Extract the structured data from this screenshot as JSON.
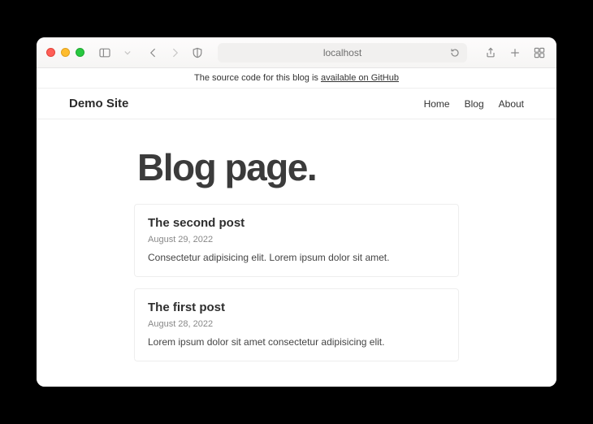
{
  "browser": {
    "address": "localhost"
  },
  "notice": {
    "prefix": "The source code for this blog is ",
    "link": "available on GitHub"
  },
  "site": {
    "title": "Demo Site",
    "nav": [
      "Home",
      "Blog",
      "About"
    ]
  },
  "page": {
    "heading": "Blog page."
  },
  "posts": [
    {
      "title": "The second post",
      "date": "August 29, 2022",
      "excerpt": "Consectetur adipisicing elit. Lorem ipsum dolor sit amet."
    },
    {
      "title": "The first post",
      "date": "August 28, 2022",
      "excerpt": "Lorem ipsum dolor sit amet consectetur adipisicing elit."
    }
  ]
}
